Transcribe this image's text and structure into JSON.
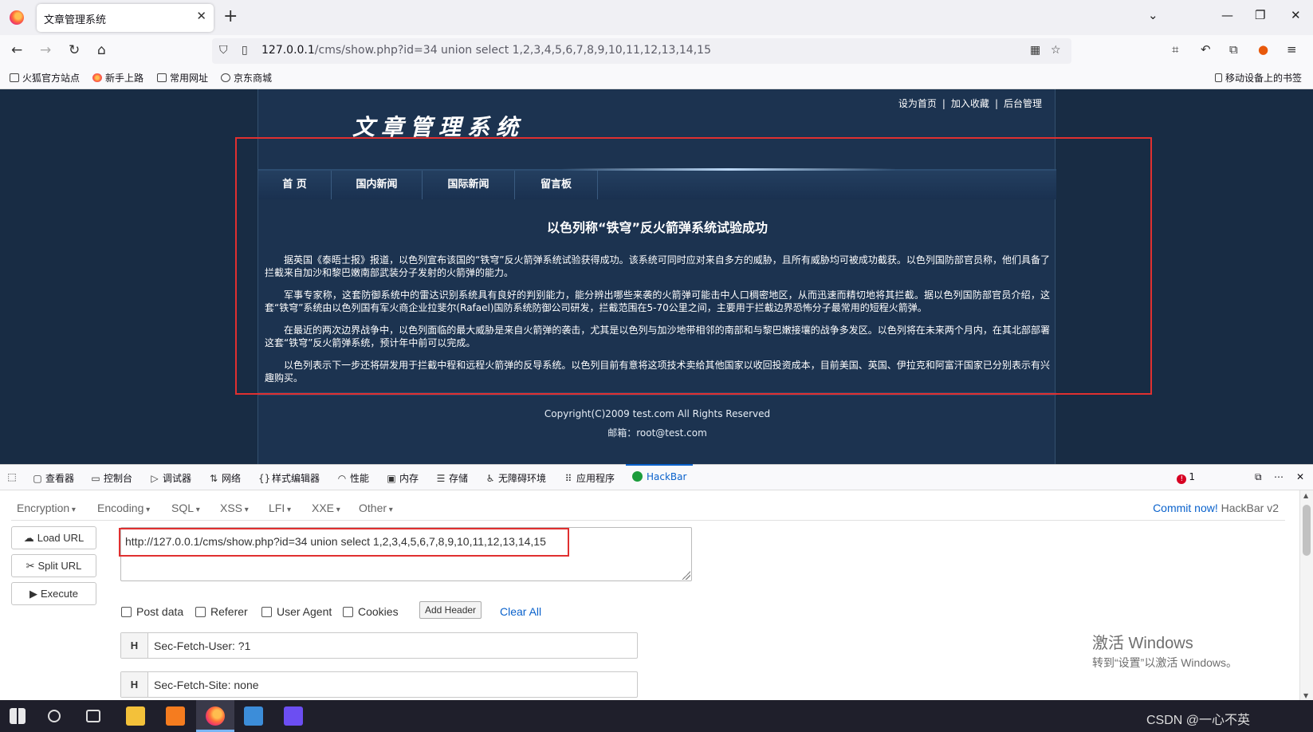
{
  "browser": {
    "tab_title": "文章管理系统",
    "url_host": "127.0.0.1",
    "url_rest": "/cms/show.php?id=34 union select 1,2,3,4,5,6,7,8,9,10,11,12,13,14,15",
    "bookmarks": [
      "火狐官方站点",
      "新手上路",
      "常用网址",
      "京东商城"
    ],
    "mobile_bookmarks": "移动设备上的书签"
  },
  "site": {
    "top_links": [
      "设为首页",
      "加入收藏",
      "后台管理"
    ],
    "separator": "|",
    "logo": "文章管理系统",
    "nav": [
      "首 页",
      "国内新闻",
      "国际新闻",
      "留言板"
    ],
    "article_title": "以色列称“铁穹”反火箭弹系统试验成功",
    "paragraphs": [
      "据英国《泰晤士报》报道，以色列宣布该国的“铁穹”反火箭弹系统试验获得成功。该系统可同时应对来自多方的威胁，且所有威胁均可被成功截获。以色列国防部官员称，他们具备了拦截来自加沙和黎巴嫩南部武装分子发射的火箭弹的能力。",
      "军事专家称，这套防御系统中的雷达识别系统具有良好的判别能力，能分辨出哪些来袭的火箭弹可能击中人口稠密地区，从而迅速而精切地将其拦截。据以色列国防部官员介绍，这套“铁穹”系统由以色列国有军火商企业拉斐尔(Rafael)国防系统防御公司研发，拦截范围在5-70公里之间，主要用于拦截边界恐怖分子最常用的短程火箭弹。",
      "在最近的两次边界战争中，以色列面临的最大威胁是来自火箭弹的袭击，尤其是以色列与加沙地带相邻的南部和与黎巴嫩接壤的战争多发区。以色列将在未来两个月内，在其北部部署这套“铁穹”反火箭弹系统，预计年中前可以完成。",
      "以色列表示下一步还将研发用于拦截中程和远程火箭弹的反导系统。以色列目前有意将这项技术卖给其他国家以收回投资成本，目前美国、英国、伊拉克和阿富汗国家已分别表示有兴趣购买。"
    ],
    "copyright": "Copyright(C)2009 test.com All Rights Reserved",
    "email": "邮箱：root@test.com"
  },
  "devtools": {
    "tabs": [
      "查看器",
      "控制台",
      "调试器",
      "网络",
      "样式编辑器",
      "性能",
      "内存",
      "存储",
      "无障碍环境",
      "应用程序",
      "HackBar"
    ],
    "error_count": "1"
  },
  "hackbar": {
    "menus": [
      "Encryption",
      "Encoding",
      "SQL",
      "XSS",
      "LFI",
      "XXE",
      "Other"
    ],
    "commit_link": "Commit now!",
    "version": "HackBar v2",
    "load_url": "Load URL",
    "split_url": "Split URL",
    "execute": "Execute",
    "url_value": "http://127.0.0.1/cms/show.php?id=34 union select 1,2,3,4,5,6,7,8,9,10,11,12,13,14,15",
    "checkboxes": [
      "Post data",
      "Referer",
      "User Agent",
      "Cookies"
    ],
    "add_header": "Add Header",
    "clear_all": "Clear All",
    "headers": [
      {
        "key": "H",
        "value": "Sec-Fetch-User: ?1"
      },
      {
        "key": "H",
        "value": "Sec-Fetch-Site: none"
      }
    ]
  },
  "watermark": {
    "line1": "激活 Windows",
    "line2": "转到“设置”以激活 Windows。"
  },
  "taskbar": {
    "right_text": "CSDN @一心不英"
  }
}
